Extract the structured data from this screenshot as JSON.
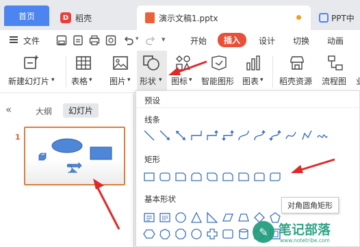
{
  "tabs": {
    "home": "首页",
    "daoke": "稻壳",
    "doc": "演示文稿1.pptx",
    "pdf": "PPT中"
  },
  "menu": {
    "file": "文件",
    "items": [
      "开始",
      "插入",
      "设计",
      "切换",
      "动画"
    ],
    "active": "插入"
  },
  "toolbar": {
    "new_slide": "新建幻灯片",
    "table": "表格",
    "picture": "图片",
    "shape": "形状",
    "icon": "图标",
    "smart_shape": "智能图形",
    "chart": "图表",
    "daoke_resources": "稻壳资源",
    "flowchart": "流程图",
    "dropdown_arrow": "▾"
  },
  "left_panel": {
    "collapse": "«",
    "outline_tab": "大纲",
    "slides_tab": "幻灯片",
    "slide_number": "1"
  },
  "dropdown": {
    "title": "预设",
    "sections": [
      "线条",
      "矩形",
      "基本形状"
    ],
    "tooltip": "对角圆角矩形"
  },
  "watermark": {
    "text": "笔记部落",
    "url": "www.notetribe.com"
  },
  "colors": {
    "accent_blue": "#4c84f0",
    "insert_active": "#e8503a",
    "shape_fill": "#4e86d8",
    "annotation_red": "#e02828",
    "watermark_green": "#1f9c7c"
  }
}
